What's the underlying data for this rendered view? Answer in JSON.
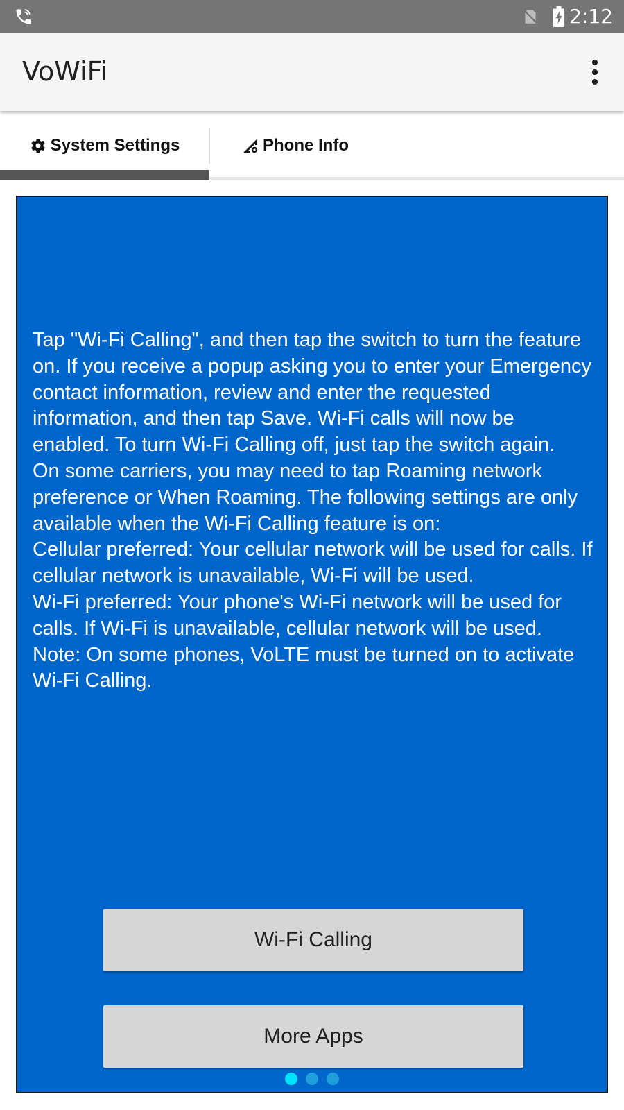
{
  "status_bar": {
    "time": "2:12",
    "icons": [
      "wifi-call-icon",
      "no-sim-icon",
      "battery-charging-icon"
    ]
  },
  "app_bar": {
    "title": "VoWiFi",
    "overflow_icon": "more-vert-icon"
  },
  "tabs": [
    {
      "label": "System Settings",
      "icon": "gear-icon",
      "selected": true
    },
    {
      "label": "Phone Info",
      "icon": "signal-settings-icon",
      "selected": false
    }
  ],
  "content": {
    "instructions": "Tap \"Wi-Fi Calling\", and then tap the switch to turn the feature on. If you receive a popup asking you to enter your Emergency contact information, review and enter the requested information, and then tap Save. Wi-Fi calls will now be enabled. To turn Wi-Fi Calling off, just tap the switch again.\nOn some carriers, you may need to tap Roaming network preference or When Roaming. The following settings are only available when the Wi-Fi Calling feature is on:\nCellular preferred: Your cellular network will be used for calls. If cellular network is unavailable, Wi-Fi will be used.\nWi-Fi preferred: Your phone's Wi-Fi network will be used for calls. If Wi-Fi is unavailable, cellular network will be used.\nNote: On some phones, VoLTE must be turned on to activate Wi-Fi Calling.",
    "wifi_calling_button": "Wi-Fi Calling",
    "more_apps_button": "More Apps"
  },
  "pager": {
    "pages": 3,
    "current": 1
  },
  "colors": {
    "status_bar": "#757575",
    "app_bar": "#f5f5f5",
    "panel": "#0066cc",
    "tab_indicator": "#555555",
    "button": "#d6d6d6",
    "dot_active": "#00e5ff",
    "dot_inactive": "#1fa0dc"
  }
}
